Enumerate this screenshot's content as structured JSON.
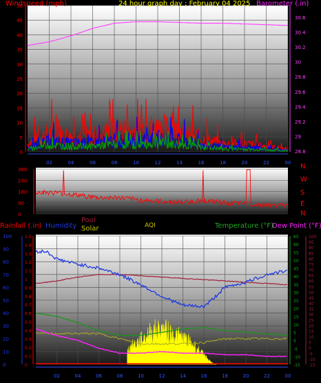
{
  "header": {
    "title": "24 hour graph day : February 04 2025",
    "left_label": "Windspeed (mph)",
    "right_label": "Barometer (.in)"
  },
  "colors": {
    "wind_gust": "#ff0000",
    "wind_avg": "#0000ff",
    "wind_low": "#00aa00",
    "barometer": "#ff44ff",
    "direction": "#ff0000",
    "humidity": "#1f3ae0",
    "pool": "#a0203a",
    "temperature": "#169a16",
    "dewpoint": "#ff22ff",
    "solar": "#ffff00",
    "rain": "#ff0000",
    "grid": "#4a4a4a",
    "axis_left": "#ff0000",
    "axis_right_bottom": "#22aa22"
  },
  "chart_data": [
    {
      "type": "line",
      "x_ticks": [
        "02",
        "04",
        "06",
        "08",
        "10",
        "12",
        "14",
        "16",
        "18",
        "20",
        "22",
        "00"
      ],
      "left_axis": {
        "label": "Windspeed (mph)",
        "ticks": [
          0,
          5,
          10,
          15,
          20,
          25,
          30,
          35,
          40,
          45,
          50
        ]
      },
      "right_axis": {
        "label": "Barometer (.in)",
        "ticks": [
          "28.8",
          "29",
          "29.2",
          "29.4",
          "29.6",
          "29.8",
          "30",
          "30.2",
          "30.4",
          "30.6"
        ]
      },
      "series": [
        {
          "name": "Barometer (.in)",
          "x": [
            0,
            2,
            4,
            6,
            8,
            10,
            12,
            14,
            16,
            18,
            20,
            22,
            24
          ],
          "values": [
            30.22,
            30.27,
            30.35,
            30.45,
            30.52,
            30.54,
            30.54,
            30.53,
            30.52,
            30.52,
            30.51,
            30.5,
            30.49
          ]
        },
        {
          "name": "Windspeed gust (mph)",
          "x": [
            0,
            2,
            4,
            6,
            8,
            10,
            12,
            14,
            16,
            18,
            20,
            22,
            24
          ],
          "values": [
            3,
            7,
            6,
            6,
            8,
            8,
            9,
            8,
            5,
            3,
            3,
            2,
            1
          ]
        }
      ]
    },
    {
      "type": "scatter",
      "left_ticks": [
        "360",
        "270",
        "180",
        "90",
        "0"
      ],
      "right_ticks": [
        "N",
        "W",
        "S",
        "E",
        "N"
      ],
      "x": [
        0,
        2,
        4,
        6,
        8,
        10,
        12,
        14,
        16,
        18,
        20,
        22,
        24
      ],
      "values": [
        175,
        170,
        150,
        130,
        130,
        110,
        100,
        95,
        105,
        90,
        80,
        70,
        65
      ]
    },
    {
      "type": "line",
      "x_ticks": [
        "02",
        "04",
        "06",
        "08",
        "10",
        "12",
        "14",
        "16",
        "18",
        "20",
        "22",
        "00"
      ],
      "labels": {
        "rainfall": "Rainfall (.in)",
        "humidity": "Humidity",
        "pool": "Pool",
        "solar": "Solar",
        "aqi": "AQI",
        "temperature": "Temperature (°F)",
        "dewpoint": "Dew Point (°F)"
      },
      "axis_humidity": [
        0,
        10,
        20,
        30,
        40,
        50,
        60,
        70,
        80,
        90,
        100
      ],
      "axis_rain": [
        "0",
        "0.1",
        "0.2",
        "0.3",
        "0.4",
        "0.5",
        "0.6",
        "0.7",
        "0.8",
        "0.9",
        "1",
        "1.1",
        "1.2",
        "1.3",
        "1.4",
        "1.5"
      ],
      "axis_temperature": [
        -15,
        -10,
        -5,
        0,
        5,
        10,
        15,
        20,
        25,
        30,
        35,
        40,
        45,
        50,
        55,
        60,
        65
      ],
      "axis_dewpoint": [
        -15,
        -10,
        -5,
        0,
        5,
        10,
        15,
        20,
        25,
        30,
        35,
        40,
        45,
        50,
        55,
        60,
        65,
        70,
        75,
        80,
        85,
        90,
        95,
        100
      ],
      "series": [
        {
          "name": "Humidity",
          "x": [
            0,
            1,
            2,
            4,
            6,
            8,
            10,
            12,
            14,
            16,
            17,
            18,
            20,
            22,
            24
          ],
          "values": [
            88,
            88,
            82,
            78,
            75,
            70,
            62,
            53,
            46,
            45,
            52,
            60,
            64,
            70,
            73
          ]
        },
        {
          "name": "Pool",
          "x": [
            0,
            2,
            4,
            6,
            8,
            24
          ],
          "values": [
            63,
            65,
            68,
            70,
            70,
            62
          ]
        },
        {
          "name": "Temperature (°F)",
          "x": [
            0,
            2,
            4,
            6,
            8,
            10,
            12,
            14,
            16,
            18,
            20,
            22,
            24
          ],
          "values": [
            17,
            15,
            11,
            6,
            3,
            3,
            5,
            7,
            8,
            6,
            5,
            4,
            3
          ]
        },
        {
          "name": "Dew Point (°F)",
          "x": [
            0,
            2,
            4,
            6,
            8,
            10,
            12,
            14,
            16,
            18,
            20,
            22,
            24
          ],
          "values": [
            7,
            3,
            0,
            -5,
            -8,
            -8,
            -7,
            -8,
            -8,
            -9,
            -9,
            -10,
            -10
          ]
        },
        {
          "name": "Solar",
          "x": [
            0,
            8,
            9,
            10,
            11,
            12,
            13,
            14,
            15,
            16,
            17,
            24
          ],
          "values": [
            0,
            0,
            40,
            55,
            75,
            80,
            70,
            60,
            45,
            20,
            0,
            0
          ]
        },
        {
          "name": "AQI",
          "x": [
            0,
            4,
            6,
            8,
            10,
            12,
            14,
            16,
            18,
            20,
            24
          ],
          "values": [
            24,
            24,
            24,
            20,
            16,
            16,
            16,
            17,
            20,
            20,
            20
          ]
        }
      ]
    }
  ]
}
